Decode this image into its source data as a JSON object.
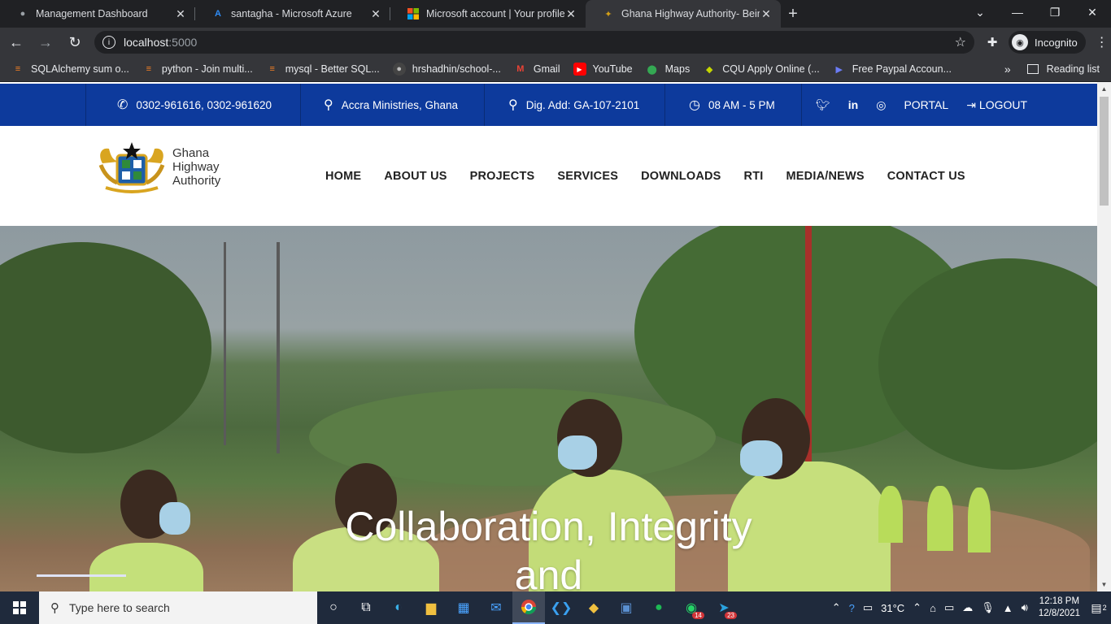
{
  "browser": {
    "tabs": [
      {
        "title": "Management Dashboard",
        "icon": "globe-icon"
      },
      {
        "title": "santagha - Microsoft Azure",
        "icon": "azure-icon"
      },
      {
        "title": "Microsoft account | Your profile",
        "icon": "microsoft-icon"
      },
      {
        "title": "Ghana Highway Authority- Being",
        "icon": "ghana-crest-icon"
      }
    ],
    "url_host": "localhost",
    "url_port": ":5000",
    "profile_label": "Incognito",
    "bookmarks": [
      {
        "label": "SQLAlchemy sum o...",
        "icon": "stackoverflow-icon"
      },
      {
        "label": "python - Join multi...",
        "icon": "stackoverflow-icon"
      },
      {
        "label": "mysql - Better SQL...",
        "icon": "stackoverflow-icon"
      },
      {
        "label": "hrshadhin/school-...",
        "icon": "github-icon"
      },
      {
        "label": "Gmail",
        "icon": "gmail-icon"
      },
      {
        "label": "YouTube",
        "icon": "youtube-icon"
      },
      {
        "label": "Maps",
        "icon": "maps-icon"
      },
      {
        "label": "CQU Apply Online (...",
        "icon": "cqu-icon"
      },
      {
        "label": "Free Paypal Accoun...",
        "icon": "paypal-icon"
      }
    ],
    "reading_list": "Reading list"
  },
  "site": {
    "topbar": {
      "phone": "0302-961616, 0302-961620",
      "location": "Accra Ministries, Ghana",
      "dig_address": "Dig. Add: GA-107-2101",
      "hours": "08 AM - 5 PM",
      "portal": "PORTAL",
      "logout": "LOGOUT"
    },
    "logo_lines": [
      "Ghana",
      "Highway",
      "Authority"
    ],
    "nav": [
      "HOME",
      "ABOUT US",
      "PROJECTS",
      "SERVICES",
      "DOWNLOADS",
      "RTI",
      "MEDIA/NEWS",
      "CONTACT US"
    ],
    "hero_line1": "Collaboration, Integrity",
    "hero_line2": "and"
  },
  "taskbar": {
    "search_placeholder": "Type here to search",
    "whatsapp_badge": "14",
    "telegram_badge": "23",
    "temperature": "31°C",
    "time": "12:18 PM",
    "date": "12/8/2021",
    "notification_count": "2"
  },
  "colors": {
    "topbar_blue": "#0d3a9c",
    "chrome_dark": "#202124",
    "chrome_toolbar": "#35363a"
  }
}
